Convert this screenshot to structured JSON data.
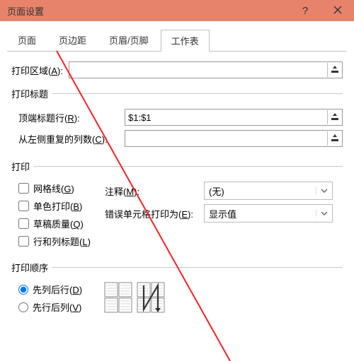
{
  "window": {
    "title": "页面设置"
  },
  "tabs": {
    "t0": "页面",
    "t1": "页边距",
    "t2": "页眉/页脚",
    "t3": "工作表"
  },
  "print_area": {
    "label_pre": "打印区域(",
    "label_key": "A",
    "label_post": "):",
    "value": ""
  },
  "titles_section": {
    "legend": "打印标题"
  },
  "top_row": {
    "label_pre": "顶端标题行(",
    "label_key": "R",
    "label_post": "):",
    "value": "$1:$1"
  },
  "left_col": {
    "label_pre": "从左侧重复的列数(",
    "label_key": "C",
    "label_post": "):",
    "value": ""
  },
  "print_section": {
    "legend": "打印"
  },
  "checkboxes": {
    "grid": {
      "pre": "网格线(",
      "key": "G",
      "post": ")"
    },
    "mono": {
      "pre": "单色打印(",
      "key": "B",
      "post": ")"
    },
    "draft": {
      "pre": "草稿质量(",
      "key": "Q",
      "post": ")"
    },
    "rowcol": {
      "pre": "行和列标题(",
      "key": "L",
      "post": ")"
    }
  },
  "notes": {
    "label_pre": "注释(",
    "label_key": "M",
    "label_post": "):",
    "value": "(无)"
  },
  "errors": {
    "label_pre": "错误单元格打印为(",
    "label_key": "E",
    "label_post": "):",
    "value": "显示值"
  },
  "order_section": {
    "legend": "打印顺序"
  },
  "order": {
    "down": {
      "pre": "先列后行(",
      "key": "D",
      "post": ")"
    },
    "over": {
      "pre": "先行后列(",
      "key": "V",
      "post": ")"
    }
  }
}
